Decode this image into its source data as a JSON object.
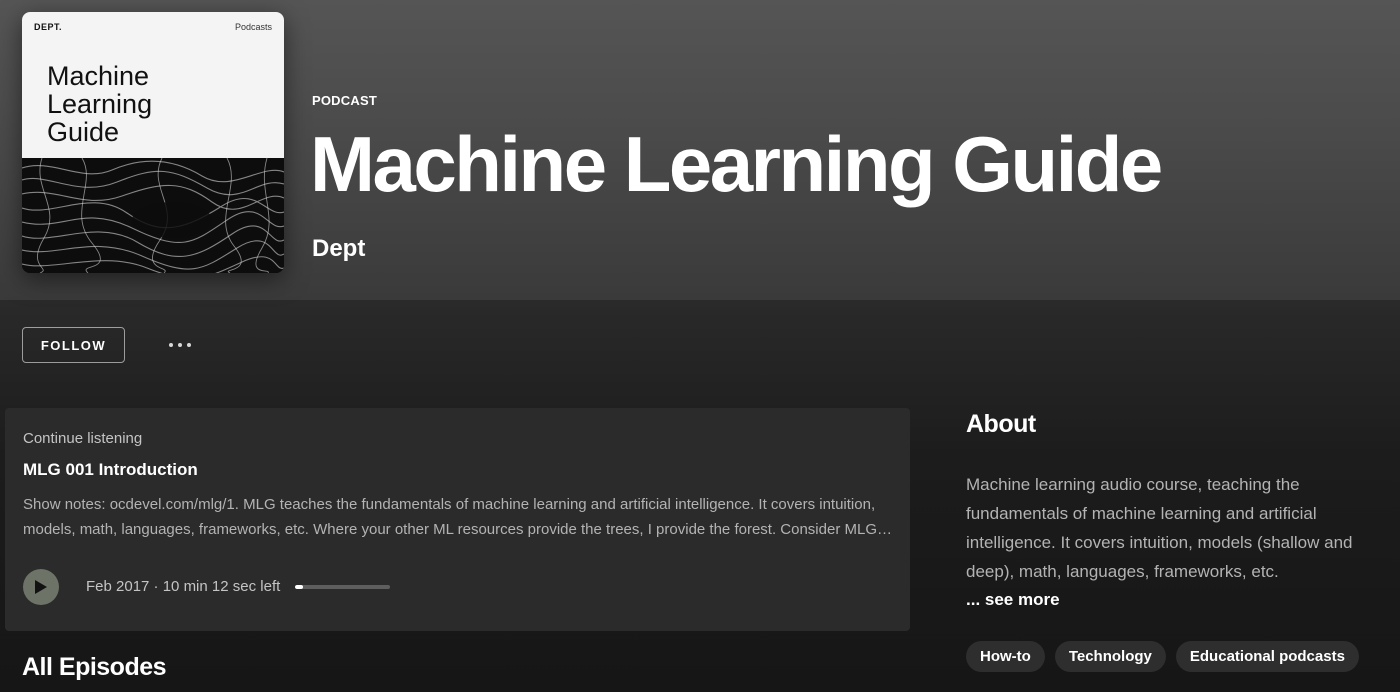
{
  "podcast": {
    "cover": {
      "brand": "DEPT.",
      "tag": "Podcasts",
      "title_lines": [
        "Machine",
        "Learning",
        "Guide"
      ]
    },
    "type_label": "PODCAST",
    "title": "Machine Learning Guide",
    "author": "Dept"
  },
  "actions": {
    "follow_label": "FOLLOW",
    "more_icon": "more-horizontal-icon"
  },
  "continue_listening": {
    "label": "Continue listening",
    "episode_title": "MLG 001 Introduction",
    "description": "Show notes: ocdevel.com/mlg/1. MLG teaches the fundamentals of machine learning and artificial intelligence. It covers intuition, models, math, languages, frameworks, etc. Where your other ML resources provide the trees, I provide the forest. Consider MLG your syllabus, with highly-curated resources for each episode's details at ocdevel.com.",
    "meta": "Feb 2017 · 10 min 12 sec left",
    "progress_fraction": 0.08,
    "play_icon": "play-icon"
  },
  "episodes": {
    "heading": "All Episodes"
  },
  "about": {
    "heading": "About",
    "text": "Machine learning audio course, teaching the fundamentals of machine learning and artificial intelligence. It covers intuition, models (shallow and deep), math, languages, frameworks, etc.",
    "see_more": "... see more",
    "tags": [
      "How-to",
      "Technology",
      "Educational podcasts"
    ]
  },
  "colors": {
    "header_bg": "#4f4f4f",
    "page_bg": "#121212",
    "card_bg": "#2b2b2b",
    "play_button": "#6d7366",
    "muted_text": "#b3b3b3"
  }
}
